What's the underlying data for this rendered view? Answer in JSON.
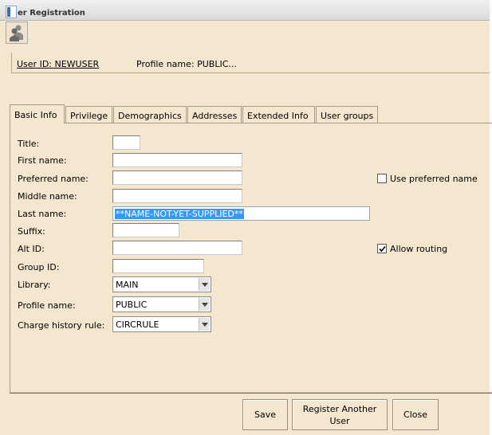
{
  "window": {
    "title": "er Registration"
  },
  "user_info": {
    "user_id": "User ID: NEWUSER",
    "profile_name": "Profile name: PUBLIC..."
  },
  "tabs": [
    {
      "label": "Basic Info",
      "active": true
    },
    {
      "label": "Privilege"
    },
    {
      "label": "Demographics"
    },
    {
      "label": "Addresses"
    },
    {
      "label": "Extended Info"
    },
    {
      "label": "User groups"
    }
  ],
  "form": {
    "title_label": "Title:",
    "first_name_label": "First name:",
    "preferred_name_label": "Preferred name:",
    "middle_name_label": "Middle name:",
    "last_name_label": "Last name:",
    "last_name_value": "**NAME-NOT-YET-SUPPLIED**",
    "suffix_label": "Suffix:",
    "alt_id_label": "Alt ID:",
    "group_id_label": "Group ID:",
    "library_label": "Library:",
    "library_value": "MAIN",
    "profile_name_label": "Profile name:",
    "profile_name_value": "PUBLIC",
    "charge_history_label": "Charge history rule:",
    "charge_history_value": "CIRCRULE",
    "use_preferred_name_label": "Use preferred name",
    "use_preferred_name_checked": false,
    "allow_routing_label": "Allow routing",
    "allow_routing_checked": true
  },
  "buttons": {
    "save": "Save",
    "register_another_line1": "Register Another",
    "register_another_line2": "User",
    "close": "Close"
  },
  "icons": {
    "toolbar": "users-icon",
    "check": "checkmark-icon",
    "dropdown": "chevron-down-icon"
  }
}
